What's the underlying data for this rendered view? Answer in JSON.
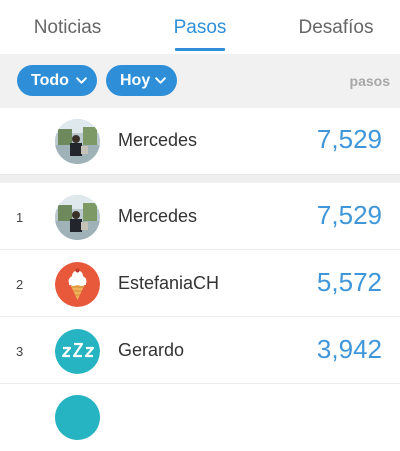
{
  "tabs": [
    {
      "label": "Noticias"
    },
    {
      "label": "Pasos"
    },
    {
      "label": "Desafíos"
    }
  ],
  "filters": {
    "scope_label": "Todo",
    "period_label": "Hoy",
    "units_label": "pasos"
  },
  "me": {
    "name": "Mercedes",
    "steps": "7,529",
    "avatar": "photo-avatar"
  },
  "ranking": [
    {
      "rank": "1",
      "name": "Mercedes",
      "steps": "7,529",
      "avatar": "photo-avatar"
    },
    {
      "rank": "2",
      "name": "EstefaniaCH",
      "steps": "5,572",
      "avatar": "ice-cream-icon"
    },
    {
      "rank": "3",
      "name": "Gerardo",
      "steps": "3,942",
      "avatar": "sleep-zzz-icon"
    }
  ],
  "colors": {
    "accent": "#2e8fd8",
    "steps_text": "#3f96d9",
    "ice_cream_avatar_bg": "#e8593c",
    "sleep_avatar_bg": "#26b3c2"
  }
}
